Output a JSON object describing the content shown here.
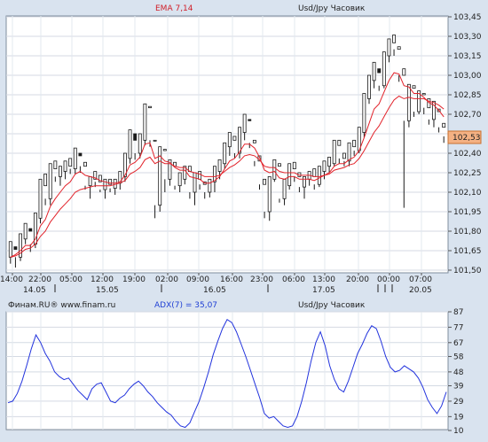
{
  "price_panel": {
    "indicator_label": "EMA 7,14",
    "instrument_label": "Usd/Jpy Часовик",
    "last_price_label": "102,53",
    "y_labels": [
      "103,45",
      "103,30",
      "103,15",
      "103,00",
      "102,85",
      "102,70",
      "102,55",
      "102,40",
      "102,25",
      "102,10",
      "101,95",
      "101,80",
      "101,65",
      "101,50"
    ],
    "x_time_labels": [
      "14:00",
      "22:00",
      "05:00",
      "12:00",
      "19:00",
      "02:00",
      "09:00",
      "16:00",
      "23:00",
      "06:00",
      "13:00",
      "20:00",
      "00:00",
      "07:00"
    ],
    "x_date_labels": [
      "14.05",
      "15.05",
      "16.05",
      "17.05",
      "20.05"
    ]
  },
  "adx_panel": {
    "source_label": "Финам.RU® www.finam.ru",
    "indicator_label": "ADX(7) = 35,07",
    "instrument_label": "Usd/Jpy Часовик",
    "y_labels": [
      "87",
      "77",
      "67",
      "58",
      "48",
      "39",
      "29",
      "19",
      "10"
    ]
  },
  "colors": {
    "background": "#d9e3ef",
    "plot_bg": "#ffffff",
    "grid": "#d4dae3",
    "ema": "#e2222a",
    "adx": "#2233dd",
    "candle": "#1a1a1a",
    "price_badge": "#f4b183"
  },
  "chart_data": [
    {
      "type": "candlestick",
      "title": "Usd/Jpy Часовик",
      "legend": [
        "EMA 7,14"
      ],
      "ylim": [
        101.5,
        103.45
      ],
      "grid": true,
      "last_price": 102.53,
      "series": [
        {
          "name": "Usd/Jpy Часовик",
          "ohlc": [
            [
              101.6,
              101.72,
              101.55,
              101.68
            ],
            [
              101.68,
              101.66,
              101.52,
              101.6
            ],
            [
              101.6,
              101.78,
              101.57,
              101.74
            ],
            [
              101.74,
              101.86,
              101.7,
              101.82
            ],
            [
              101.82,
              101.8,
              101.64,
              101.7
            ],
            [
              101.7,
              101.94,
              101.67,
              101.9
            ],
            [
              101.9,
              102.2,
              101.86,
              102.15
            ],
            [
              102.15,
              102.24,
              102.0,
              102.05
            ],
            [
              102.05,
              102.32,
              102.0,
              102.28
            ],
            [
              102.28,
              102.34,
              102.18,
              102.22
            ],
            [
              102.22,
              102.3,
              102.15,
              102.26
            ],
            [
              102.26,
              102.34,
              102.2,
              102.3
            ],
            [
              102.3,
              102.36,
              102.24,
              102.28
            ],
            [
              102.28,
              102.44,
              102.24,
              102.4
            ],
            [
              102.4,
              102.38,
              102.25,
              102.3
            ],
            [
              102.3,
              102.33,
              102.12,
              102.15
            ],
            [
              102.15,
              102.22,
              102.05,
              102.2
            ],
            [
              102.2,
              102.26,
              102.14,
              102.18
            ],
            [
              102.18,
              102.23,
              102.1,
              102.12
            ],
            [
              102.12,
              102.2,
              102.05,
              102.16
            ],
            [
              102.16,
              102.2,
              102.1,
              102.13
            ],
            [
              102.13,
              102.2,
              102.08,
              102.17
            ],
            [
              102.17,
              102.26,
              102.12,
              102.22
            ],
            [
              102.22,
              102.4,
              102.18,
              102.36
            ],
            [
              102.36,
              102.58,
              102.32,
              102.55
            ],
            [
              102.55,
              102.5,
              102.35,
              102.4
            ],
            [
              102.4,
              102.55,
              102.36,
              102.5
            ],
            [
              102.5,
              102.78,
              102.46,
              102.75
            ],
            [
              102.75,
              102.76,
              102.45,
              102.5
            ],
            [
              102.5,
              102.5,
              101.9,
              102.0
            ],
            [
              102.0,
              102.45,
              101.95,
              102.42
            ],
            [
              102.42,
              102.43,
              102.1,
              102.2
            ],
            [
              102.2,
              102.35,
              102.15,
              102.3
            ],
            [
              102.3,
              102.33,
              102.12,
              102.15
            ],
            [
              102.15,
              102.25,
              102.1,
              102.2
            ],
            [
              102.2,
              102.3,
              102.16,
              102.26
            ],
            [
              102.26,
              102.3,
              102.05,
              102.1
            ],
            [
              102.1,
              102.25,
              102.0,
              102.2
            ],
            [
              102.2,
              102.26,
              102.12,
              102.16
            ],
            [
              102.16,
              102.18,
              102.05,
              102.1
            ],
            [
              102.1,
              102.2,
              102.06,
              102.18
            ],
            [
              102.18,
              102.3,
              102.1,
              102.26
            ],
            [
              102.26,
              102.35,
              102.2,
              102.32
            ],
            [
              102.32,
              102.48,
              102.28,
              102.45
            ],
            [
              102.45,
              102.56,
              102.38,
              102.5
            ],
            [
              102.5,
              102.53,
              102.36,
              102.4
            ],
            [
              102.4,
              102.6,
              102.36,
              102.56
            ],
            [
              102.56,
              102.7,
              102.5,
              102.66
            ],
            [
              102.66,
              102.65,
              102.44,
              102.48
            ],
            [
              102.48,
              102.5,
              102.3,
              102.34
            ],
            [
              102.34,
              102.38,
              102.12,
              102.16
            ],
            [
              102.16,
              102.2,
              101.9,
              101.95
            ],
            [
              101.95,
              102.22,
              101.88,
              102.2
            ],
            [
              102.2,
              102.35,
              102.18,
              102.3
            ],
            [
              102.3,
              102.32,
              102.02,
              102.05
            ],
            [
              102.05,
              102.2,
              102.0,
              102.15
            ],
            [
              102.15,
              102.32,
              102.12,
              102.28
            ],
            [
              102.28,
              102.33,
              102.18,
              102.22
            ],
            [
              102.22,
              102.25,
              102.1,
              102.14
            ],
            [
              102.14,
              102.22,
              102.05,
              102.2
            ],
            [
              102.2,
              102.26,
              102.15,
              102.22
            ],
            [
              102.22,
              102.28,
              102.12,
              102.16
            ],
            [
              102.16,
              102.3,
              102.14,
              102.26
            ],
            [
              102.26,
              102.34,
              102.2,
              102.3
            ],
            [
              102.3,
              102.37,
              102.25,
              102.32
            ],
            [
              102.32,
              102.5,
              102.3,
              102.46
            ],
            [
              102.46,
              102.5,
              102.32,
              102.36
            ],
            [
              102.36,
              102.4,
              102.3,
              102.34
            ],
            [
              102.34,
              102.48,
              102.3,
              102.45
            ],
            [
              102.45,
              102.5,
              102.38,
              102.42
            ],
            [
              102.42,
              102.6,
              102.4,
              102.56
            ],
            [
              102.56,
              102.86,
              102.52,
              102.82
            ],
            [
              102.82,
              103.0,
              102.78,
              102.96
            ],
            [
              102.96,
              103.1,
              102.9,
              103.05
            ],
            [
              103.05,
              103.02,
              102.88,
              102.92
            ],
            [
              102.92,
              103.18,
              102.9,
              103.15
            ],
            [
              103.15,
              103.28,
              103.1,
              103.25
            ],
            [
              103.25,
              103.31,
              103.15,
              103.2
            ],
            [
              103.2,
              103.22,
              102.95,
              103.0
            ],
            [
              103.0,
              103.05,
              101.98,
              102.65
            ],
            [
              102.65,
              102.93,
              102.6,
              102.9
            ],
            [
              102.9,
              102.92,
              102.68,
              102.72
            ],
            [
              102.72,
              102.88,
              102.7,
              102.85
            ],
            [
              102.85,
              102.86,
              102.7,
              102.75
            ],
            [
              102.75,
              102.82,
              102.62,
              102.66
            ],
            [
              102.66,
              102.8,
              102.6,
              102.72
            ],
            [
              102.72,
              102.74,
              102.56,
              102.6
            ],
            [
              102.6,
              102.63,
              102.48,
              102.53
            ]
          ]
        },
        {
          "name": "EMA 7",
          "values": [
            101.6,
            101.62,
            101.65,
            101.69,
            101.69,
            101.74,
            101.84,
            101.89,
            101.99,
            102.05,
            102.1,
            102.15,
            102.18,
            102.24,
            102.26,
            102.23,
            102.22,
            102.21,
            102.19,
            102.18,
            102.17,
            102.17,
            102.18,
            102.23,
            102.31,
            102.33,
            102.37,
            102.47,
            102.48,
            102.36,
            102.38,
            102.34,
            102.33,
            102.29,
            102.27,
            102.27,
            102.22,
            102.21,
            102.2,
            102.17,
            102.17,
            102.19,
            102.22,
            102.28,
            102.34,
            102.36,
            102.41,
            102.47,
            102.47,
            102.44,
            102.37,
            102.27,
            102.25,
            102.26,
            102.21,
            102.2,
            102.22,
            102.22,
            102.2,
            102.2,
            102.2,
            102.19,
            102.21,
            102.23,
            102.25,
            102.3,
            102.32,
            102.32,
            102.35,
            102.37,
            102.42,
            102.52,
            102.63,
            102.74,
            102.78,
            102.87,
            102.96,
            103.02,
            103.01,
            102.92,
            102.91,
            102.86,
            102.86,
            102.83,
            102.79,
            102.77,
            102.73,
            102.68
          ]
        },
        {
          "name": "EMA 14",
          "values": [
            101.6,
            101.61,
            101.63,
            101.66,
            101.67,
            101.7,
            101.76,
            101.8,
            101.87,
            101.92,
            101.97,
            102.01,
            102.05,
            102.1,
            102.12,
            102.13,
            102.14,
            102.15,
            102.15,
            102.15,
            102.15,
            102.16,
            102.17,
            102.19,
            102.24,
            102.26,
            102.29,
            102.35,
            102.37,
            102.32,
            102.34,
            102.32,
            102.32,
            102.3,
            102.29,
            102.29,
            102.26,
            102.25,
            102.24,
            102.22,
            102.22,
            102.22,
            102.23,
            102.26,
            102.29,
            102.31,
            102.34,
            102.38,
            102.39,
            102.38,
            102.35,
            102.3,
            102.29,
            102.29,
            102.26,
            102.25,
            102.25,
            102.25,
            102.23,
            102.23,
            102.23,
            102.22,
            102.22,
            102.23,
            102.24,
            102.27,
            102.28,
            102.29,
            102.31,
            102.32,
            102.36,
            102.42,
            102.49,
            102.56,
            102.61,
            102.68,
            102.75,
            102.81,
            102.84,
            102.82,
            102.83,
            102.82,
            102.82,
            102.82,
            102.8,
            102.79,
            102.77,
            102.74
          ]
        }
      ]
    },
    {
      "type": "line",
      "title": "ADX(7) = 35,07",
      "ylim": [
        10,
        87
      ],
      "grid": true,
      "series": [
        {
          "name": "ADX(7)",
          "values": [
            28,
            29,
            34,
            42,
            52,
            63,
            72,
            67,
            60,
            55,
            48,
            45,
            43,
            44,
            40,
            36,
            33,
            30,
            37,
            40,
            41,
            35,
            29,
            28,
            31,
            33,
            37,
            40,
            42,
            39,
            35,
            32,
            28,
            25,
            22,
            20,
            16,
            13,
            12,
            15,
            22,
            29,
            38,
            48,
            59,
            68,
            76,
            82,
            80,
            74,
            66,
            58,
            49,
            40,
            31,
            21,
            18,
            19,
            16,
            13,
            12,
            13,
            19,
            29,
            41,
            55,
            67,
            74,
            65,
            52,
            43,
            37,
            35,
            42,
            51,
            60,
            66,
            73,
            78,
            76,
            68,
            58,
            51,
            48,
            49,
            52,
            50,
            48,
            44,
            38,
            30,
            25,
            21,
            26,
            35
          ]
        }
      ]
    }
  ]
}
